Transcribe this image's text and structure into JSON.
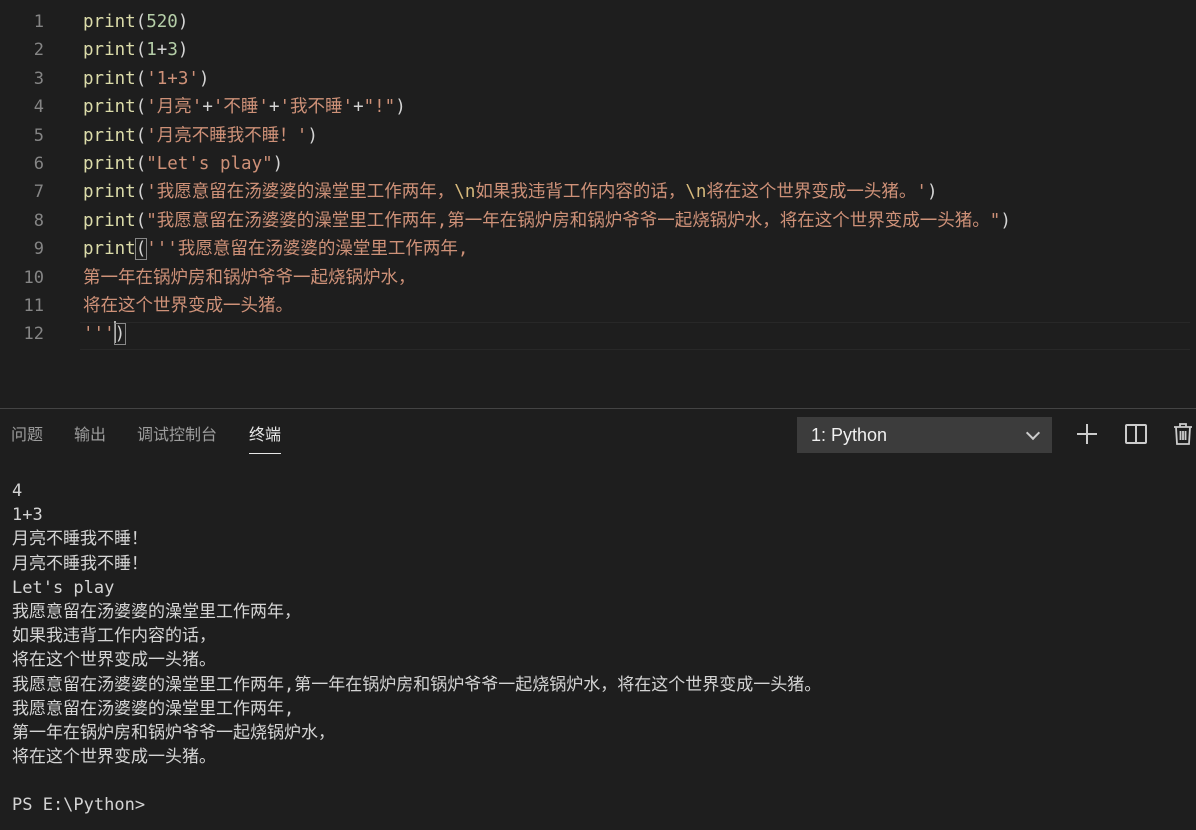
{
  "editor": {
    "line_numbers": [
      "1",
      "2",
      "3",
      "4",
      "5",
      "6",
      "7",
      "8",
      "9",
      "10",
      "11",
      "12"
    ],
    "lines": [
      [
        {
          "t": "print",
          "c": "fn"
        },
        {
          "t": "(",
          "c": "pn"
        },
        {
          "t": "520",
          "c": "num"
        },
        {
          "t": ")",
          "c": "pn"
        }
      ],
      [
        {
          "t": "print",
          "c": "fn"
        },
        {
          "t": "(",
          "c": "pn"
        },
        {
          "t": "1",
          "c": "num"
        },
        {
          "t": "+",
          "c": "pn"
        },
        {
          "t": "3",
          "c": "num"
        },
        {
          "t": ")",
          "c": "pn"
        }
      ],
      [
        {
          "t": "print",
          "c": "fn"
        },
        {
          "t": "(",
          "c": "pn"
        },
        {
          "t": "'1+3'",
          "c": "str"
        },
        {
          "t": ")",
          "c": "pn"
        }
      ],
      [
        {
          "t": "print",
          "c": "fn"
        },
        {
          "t": "(",
          "c": "pn"
        },
        {
          "t": "'月亮'",
          "c": "str"
        },
        {
          "t": "+",
          "c": "pn"
        },
        {
          "t": "'不睡'",
          "c": "str"
        },
        {
          "t": "+",
          "c": "pn"
        },
        {
          "t": "'我不睡'",
          "c": "str"
        },
        {
          "t": "+",
          "c": "pn"
        },
        {
          "t": "\"!\"",
          "c": "str"
        },
        {
          "t": ")",
          "c": "pn"
        }
      ],
      [
        {
          "t": "print",
          "c": "fn"
        },
        {
          "t": "(",
          "c": "pn"
        },
        {
          "t": "'月亮不睡我不睡！'",
          "c": "str"
        },
        {
          "t": ")",
          "c": "pn"
        }
      ],
      [
        {
          "t": "print",
          "c": "fn"
        },
        {
          "t": "(",
          "c": "pn"
        },
        {
          "t": "\"Let's play\"",
          "c": "str"
        },
        {
          "t": ")",
          "c": "pn"
        }
      ],
      [
        {
          "t": "print",
          "c": "fn"
        },
        {
          "t": "(",
          "c": "pn"
        },
        {
          "t": "'我愿意留在汤婆婆的澡堂里工作两年，",
          "c": "str"
        },
        {
          "t": "\\n",
          "c": "esc"
        },
        {
          "t": "如果我违背工作内容的话，",
          "c": "str"
        },
        {
          "t": "\\n",
          "c": "esc"
        },
        {
          "t": "将在这个世界变成一头猪。'",
          "c": "str"
        },
        {
          "t": ")",
          "c": "pn"
        }
      ],
      [
        {
          "t": "print",
          "c": "fn"
        },
        {
          "t": "(",
          "c": "pn"
        },
        {
          "t": "\"我愿意留在汤婆婆的澡堂里工作两年,第一年在锅炉房和锅炉爷爷一起烧锅炉水，将在这个世界变成一头猪。\"",
          "c": "str"
        },
        {
          "t": ")",
          "c": "pn"
        }
      ],
      [
        {
          "t": "print",
          "c": "fn"
        },
        {
          "t": "(",
          "c": "pn",
          "m": true
        },
        {
          "t": "'''我愿意留在汤婆婆的澡堂里工作两年,",
          "c": "str"
        }
      ],
      [
        {
          "t": "第一年在锅炉房和锅炉爷爷一起烧锅炉水，",
          "c": "str"
        }
      ],
      [
        {
          "t": "将在这个世界变成一头猪。",
          "c": "str"
        }
      ],
      [
        {
          "t": "'''",
          "c": "str"
        },
        {
          "t": ")",
          "c": "pn",
          "m": true
        }
      ]
    ]
  },
  "panel": {
    "tabs": [
      "问题",
      "输出",
      "调试控制台",
      "终端"
    ],
    "active_tab": "终端",
    "terminal_select": {
      "value": "1: Python"
    },
    "actions": [
      {
        "name": "new-terminal-icon",
        "icon": "plus"
      },
      {
        "name": "split-terminal-icon",
        "icon": "split"
      },
      {
        "name": "kill-terminal-icon",
        "icon": "trash"
      }
    ]
  },
  "terminal": {
    "lines": [
      "4",
      "1+3",
      "月亮不睡我不睡！",
      "月亮不睡我不睡！",
      "Let's play",
      "我愿意留在汤婆婆的澡堂里工作两年，",
      "如果我违背工作内容的话，",
      "将在这个世界变成一头猪。",
      "我愿意留在汤婆婆的澡堂里工作两年,第一年在锅炉房和锅炉爷爷一起烧锅炉水，将在这个世界变成一头猪。",
      "我愿意留在汤婆婆的澡堂里工作两年,",
      "第一年在锅炉房和锅炉爷爷一起烧锅炉水，",
      "将在这个世界变成一头猪。",
      "",
      "PS E:\\Python>"
    ]
  },
  "colors": {
    "background": "#1e1e1e",
    "function": "#dcdcaa",
    "string": "#ce9178",
    "number": "#b5cea8",
    "escape": "#d7ba7d",
    "line_number": "#858585",
    "terminal_text": "#d4d4d4"
  }
}
